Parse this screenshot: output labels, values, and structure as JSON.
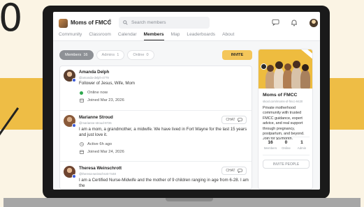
{
  "background": {
    "glyph": "0"
  },
  "header": {
    "community_name": "Moms of FMCC",
    "search_placeholder": "Search members"
  },
  "tabs": [
    {
      "label": "Community"
    },
    {
      "label": "Classroom"
    },
    {
      "label": "Calendar"
    },
    {
      "label": "Members",
      "active": true
    },
    {
      "label": "Map"
    },
    {
      "label": "Leaderboards"
    },
    {
      "label": "About"
    }
  ],
  "filters": [
    {
      "label": "Members",
      "count": "16"
    },
    {
      "label": "Admins",
      "count": "1"
    },
    {
      "label": "Online",
      "count": "0"
    }
  ],
  "invite_label": "INVITE",
  "chat_label": "CHAT",
  "members": [
    {
      "name": "Amanda Delph",
      "handle": "@amanda-delph-4779",
      "bio": "Follower of Jesus, Wife, Mom",
      "status": "Online now",
      "joined": "Joined Mar 23, 2026"
    },
    {
      "name": "Marianne Stroud",
      "handle": "@marianne-stroud-9726",
      "bio": "I am a mom, a grandmother, a midwife. We have lived in Fort Wayne for the last 15 years and just love it.",
      "status": "Active 6h ago",
      "joined": "Joined Mar 24, 2026"
    },
    {
      "name": "Theresa Weinschrott",
      "handle": "@theresa-weinschrott-7448",
      "bio": "I am a Certified Nurse-Midwife and the mother of 9 children ranging in age from 6-28. I am the"
    }
  ],
  "about_card": {
    "title": "Moms of FMCC",
    "url": "skool.com/moms-of-fmcc-9420",
    "description": "Private motherhood community with trusted FMCC guidance, expert advice, and real support through pregnancy, postpartum, and beyond. Join for $5/month.",
    "stats": [
      {
        "value": "16",
        "label": "Members"
      },
      {
        "value": "0",
        "label": "Online"
      },
      {
        "value": "1",
        "label": "Admin"
      }
    ],
    "invite_button": "INVITE PEOPLE"
  },
  "colors": {
    "accent": "#f4c65a",
    "online": "#2fa84f",
    "background_band": "#eebd45",
    "page_background": "#fbf4e4"
  }
}
